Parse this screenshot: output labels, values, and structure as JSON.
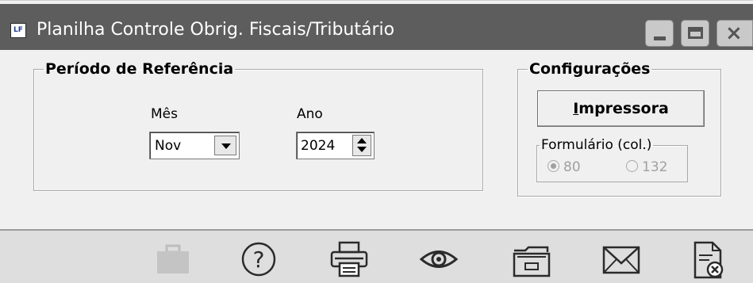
{
  "window": {
    "icon_text": "LF",
    "title": "Planilha Controle Obrig. Fiscais/Tributário"
  },
  "periodo": {
    "legend": "Período de Referência",
    "mes_label": "Mês",
    "mes_value": "Nov",
    "ano_label": "Ano",
    "ano_value": "2024"
  },
  "config": {
    "legend": "Configurações",
    "impressora_mnemonic": "I",
    "impressora_rest": "mpressora",
    "formulario_legend": "Formulário (col.)",
    "radio_80": "80",
    "radio_132": "132",
    "selected": "80"
  },
  "toolbar": {
    "icons": [
      "briefcase-icon",
      "help-icon",
      "printer-icon",
      "preview-eye-icon",
      "folder-icon",
      "envelope-icon",
      "close-document-icon"
    ]
  }
}
